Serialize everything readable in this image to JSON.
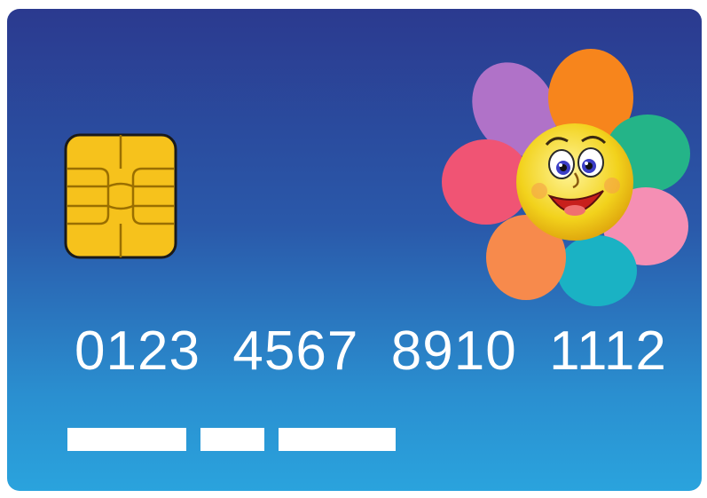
{
  "card": {
    "number_groups": [
      "0123",
      "4567",
      "8910",
      "1112"
    ],
    "chip_icon": "sim-chip-icon",
    "flower_icon": "smiling-flower-icon",
    "colors": {
      "card_top": "#2b3a8f",
      "card_bottom": "#2aa3dd",
      "chip": "#f6c21c",
      "text": "#ffffff"
    }
  }
}
